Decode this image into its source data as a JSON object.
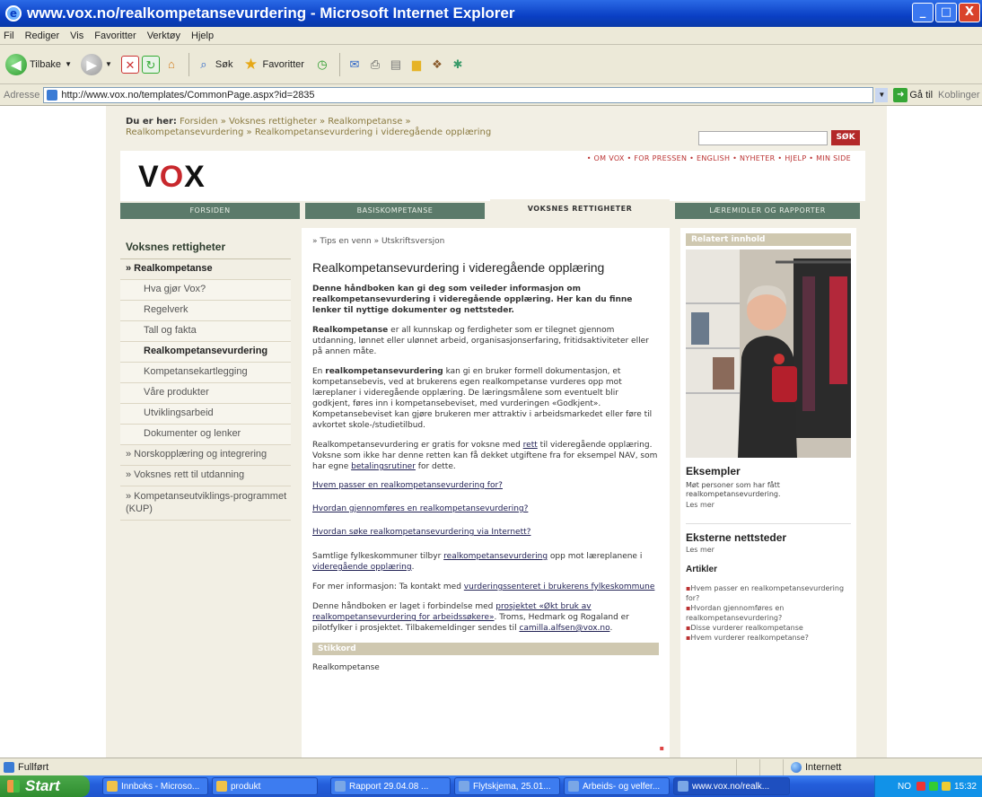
{
  "window": {
    "title": "www.vox.no/realkompetansevurdering - Microsoft Internet Explorer",
    "minimize": "_",
    "maximize": "□",
    "close": "X"
  },
  "menu": [
    "Fil",
    "Rediger",
    "Vis",
    "Favoritter",
    "Verktøy",
    "Hjelp"
  ],
  "toolbar": {
    "back_label": "Tilbake",
    "search_label": "Søk",
    "favorites_label": "Favoritter"
  },
  "address": {
    "label": "Adresse",
    "url": "http://www.vox.no/templates/CommonPage.aspx?id=2835",
    "go_label": "Gå til",
    "links_label": "Koblinger"
  },
  "page": {
    "breadcrumb_prefix": "Du er her:",
    "breadcrumb_line1": "Forsiden » Voksnes rettigheter » Realkompetanse »",
    "breadcrumb_line2": "Realkompetansevurdering » Realkompetansevurdering i videregående opplæring",
    "search_button": "SØK",
    "logo_v": "V",
    "logo_o": "O",
    "logo_x": "X",
    "toplinks": "• OM VOX  • FOR PRESSEN  • ENGLISH  • NYHETER  • HJELP  • MIN SIDE",
    "tabs": [
      "FORSIDEN",
      "BASISKOMPETANSE",
      "VOKSNES RETTIGHETER",
      "LÆREMIDLER OG RAPPORTER"
    ],
    "leftnav": {
      "title": "Voksnes rettigheter",
      "items": [
        "» Realkompetanse",
        "Hva gjør Vox?",
        "Regelverk",
        "Tall og fakta",
        "Realkompetansevurdering",
        "Kompetansekartlegging",
        "Våre produkter",
        "Utviklingsarbeid",
        "Dokumenter og lenker",
        "» Norskopplæring og integrering",
        "» Voksnes rett til utdanning",
        "» Kompetanseutviklings-programmet (KUP)"
      ]
    },
    "content": {
      "utils": "» Tips en venn  » Utskriftsversjon",
      "title": "Realkompetansevurdering i videregående opplæring",
      "lead": "Denne håndboken kan gi deg som veileder informasjon om realkompetansevurdering i videregående opplæring. Her kan du finne lenker til nyttige dokumenter og nettsteder.",
      "p1_bold": "Realkompetanse",
      "p1_rest": " er all kunnskap og ferdigheter som er tilegnet gjennom utdanning, lønnet eller ulønnet arbeid, organisasjonserfaring, fritidsaktiviteter eller på annen måte.",
      "p2_a": "En ",
      "p2_bold": "realkompetansevurdering",
      "p2_rest": " kan gi en bruker formell dokumentasjon, et kompetansebevis, ved at brukerens egen realkompetanse vurderes opp mot læreplaner i videregående opplæring. De læringsmålene som eventuelt blir godkjent, føres inn i kompetansebeviset, med vurderingen «Godkjent». Kompetansebeviset kan gjøre brukeren mer attraktiv i arbeidsmarkedet eller føre til avkortet skole-/studietilbud.",
      "p3_a": "Realkompetansevurdering er gratis for voksne med ",
      "p3_link1": "rett",
      "p3_b": " til videregående opplæring. Voksne som ikke har denne retten kan få dekket utgiftene fra for eksempel NAV, som har egne ",
      "p3_link2": "betalingsrutiner",
      "p3_c": " for dette.",
      "link1": "Hvem passer en realkompetansevurdering for?",
      "link2": "Hvordan gjennomføres en realkompetansevurdering?",
      "link3": "Hvordan søke realkompetansevurdering via Internett?",
      "p4_a": "Samtlige fylkeskommuner tilbyr ",
      "p4_link": "realkompetansevurdering",
      "p4_b": " opp mot læreplanene i ",
      "p4_link2": "videregående opplæring",
      "p4_c": ".",
      "p5_a": "For mer informasjon: Ta kontakt med ",
      "p5_link": "vurderingssenteret i brukerens fylkeskommune",
      "p6_a": "Denne håndboken er laget i forbindelse med ",
      "p6_link": "prosjektet «Økt bruk av realkompetansevurdering for arbeidssøkere»",
      "p6_b": ". Troms, Hedmark og Rogaland er pilotfylker i prosjektet. Tilbakemeldinger sendes til ",
      "p6_link2": "camilla.alfsen@vox.no",
      "p6_c": ".",
      "stikkord_label": "Stikkord",
      "stikkord_value": "Realkompetanse"
    },
    "right": {
      "related_head": "Relatert innhold",
      "ex_title": "Eksempler",
      "ex_text": "Møt personer som har fått realkompetansevurdering.",
      "ex_more": "Les mer",
      "ext_title": "Eksterne nettsteder",
      "ext_more": "Les mer",
      "art_title": "Artikler",
      "articles": [
        "Hvem passer en realkompetansevurdering for?",
        "Hvordan gjennomføres en realkompetansevurdering?",
        "Disse vurderer realkompetanse",
        "Hvem vurderer realkompetanse?"
      ]
    }
  },
  "status": {
    "text": "Fullført",
    "zone": "Internett"
  },
  "taskbar": {
    "start": "Start",
    "tasks": [
      "Innboks - Microso...",
      "produkt",
      "Rapport 29.04.08 ...",
      "Flytskjema, 25.01...",
      "Arbeids- og velfer...",
      "www.vox.no/realk..."
    ],
    "tray_lang": "NO",
    "clock": "15:32"
  },
  "colors": {
    "accent_red": "#c8282d",
    "tab_green": "#5b7a6a",
    "page_beige": "#f2efe4"
  }
}
